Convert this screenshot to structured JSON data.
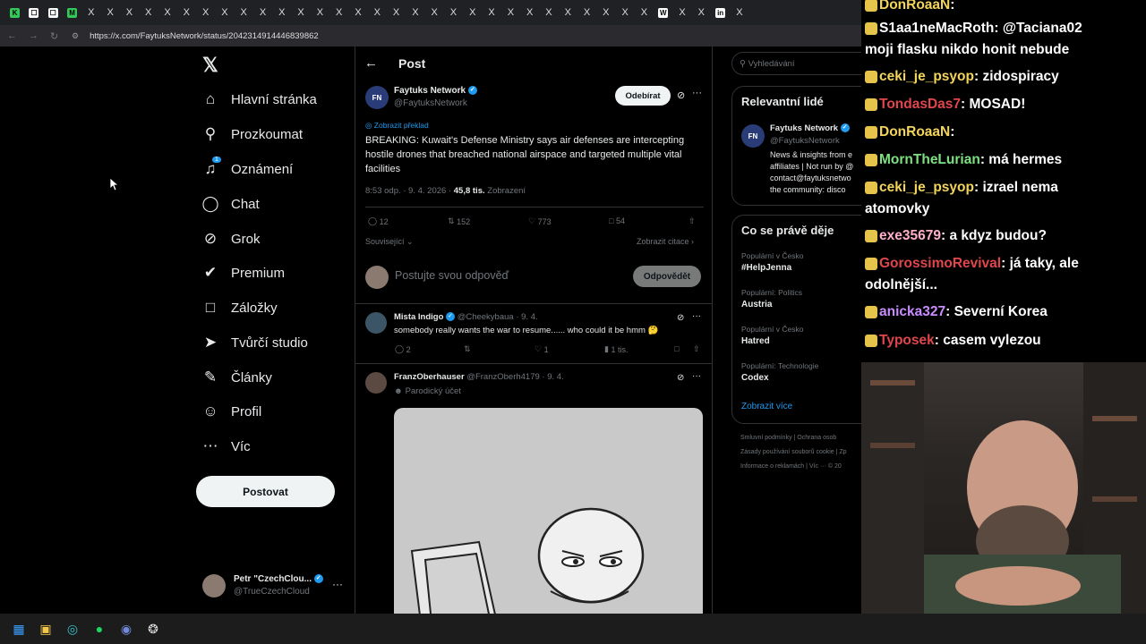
{
  "browser": {
    "url": "https://x.com/FaytuksNetwork/status/2042314914446839862",
    "tab_marks": [
      "K",
      "☐",
      "☐",
      "M",
      "X",
      "X",
      "X",
      "X",
      "X",
      "X",
      "X",
      "X",
      "X",
      "X",
      "X",
      "X",
      "X",
      "X",
      "X",
      "X",
      "X",
      "X",
      "X",
      "X",
      "X",
      "X",
      "X",
      "X",
      "X",
      "X",
      "X",
      "X",
      "X",
      "X",
      "W",
      "X",
      "X",
      "in",
      "X"
    ]
  },
  "nav": {
    "home": "Hlavní stránka",
    "explore": "Prozkoumat",
    "notifications": "Oznámení",
    "notif_count": "1",
    "chat": "Chat",
    "grok": "Grok",
    "premium": "Premium",
    "bookmarks": "Záložky",
    "creator_studio": "Tvůrčí studio",
    "articles": "Články",
    "profile": "Profil",
    "more": "Víc",
    "post_button": "Postovat",
    "account_name": "Petr \"CzechClou...",
    "account_handle": "@TrueCzechCloud"
  },
  "main": {
    "header_title": "Post",
    "post": {
      "author_name": "Faytuks Network",
      "author_handle": "@FaytuksNetwork",
      "follow_label": "Odebírat",
      "translate_label": "Zobrazit překlad",
      "text": "BREAKING: Kuwait's Defense Ministry says air defenses are intercepting hostile drones that breached national airspace and targeted multiple vital facilities",
      "time": "8:53 odp. · 9. 4. 2026 ·",
      "views_count": "45,8 tis.",
      "views_label": "Zobrazení",
      "replies": "12",
      "reposts": "152",
      "likes": "773",
      "bookmarks": "54",
      "related_label": "Související",
      "quotes_label": "Zobrazit citace"
    },
    "reply_box": {
      "placeholder": "Postujte svou odpověď",
      "button": "Odpovědět"
    },
    "replies": [
      {
        "name": "Mista Indigo",
        "handle": "@Cheekybaua",
        "date": "· 9. 4.",
        "text": "somebody really wants the war to resume...... who could it be hmm 🤔",
        "replies": "2",
        "likes": "1",
        "views": "1 tis."
      },
      {
        "name": "FranzOberhauser",
        "handle": "@FranzOberh4179",
        "date": "· 9. 4.",
        "subtitle": "Parodický účet"
      }
    ]
  },
  "sidebar": {
    "search_placeholder": "Vyhledávání",
    "relevant_title": "Relevantní lidé",
    "relevant_name": "Faytuks Network",
    "relevant_handle": "@FaytuksNetwork",
    "relevant_bio_1": "News & insights from e",
    "relevant_bio_2": "affiliates | Not run by @",
    "relevant_bio_3": "contact@faytuksnetwo",
    "relevant_bio_4": "the community: disco",
    "trends_title": "Co se právě děje",
    "trends": [
      {
        "context": "Populární v Česko",
        "name": "#HelpJenna"
      },
      {
        "context": "Populární: Politics",
        "name": "Austria"
      },
      {
        "context": "Populární v Česko",
        "name": "Hatred"
      },
      {
        "context": "Populární: Technologie",
        "name": "Codex"
      }
    ],
    "show_more": "Zobrazit více",
    "footer_1": "Smluvní podmínky  |  Ochrana osob",
    "footer_2": "Zásady používání souborů cookie  |  Zp",
    "footer_3": "Informace o reklamách  |  Víc ···  © 20"
  },
  "chat": [
    {
      "user": "DonRoaaN",
      "color": "#f3d55b",
      "msg": ""
    },
    {
      "user": "S1aa1neMacRoth",
      "color": "#ffffff",
      "msg": "@Taciana02"
    },
    {
      "user": "",
      "color": "#ffffff",
      "msg": "moji flasku nikdo honit nebude"
    },
    {
      "user": "ceki_je_psyop",
      "color": "#f3d55b",
      "msg": "zidospiracy"
    },
    {
      "user": "TondasDas7",
      "color": "#e0464c",
      "msg": "MOSAD!"
    },
    {
      "user": "DonRoaaN",
      "color": "#f3d55b",
      "msg": ""
    },
    {
      "user": "MornTheLurian",
      "color": "#7ee081",
      "msg": "má hermes"
    },
    {
      "user": "ceki_je_psyop",
      "color": "#f3d55b",
      "msg": "izrael nema"
    },
    {
      "user": "",
      "color": "#ffffff",
      "msg": "atomovky"
    },
    {
      "user": "exe35679",
      "color": "#ffb0c8",
      "msg": "a kdyz budou?"
    },
    {
      "user": "GorossimoRevival",
      "color": "#e0464c",
      "msg": "já taky, ale"
    },
    {
      "user": "",
      "color": "#ffffff",
      "msg": "odolnější..."
    },
    {
      "user": "anicka327",
      "color": "#c98cff",
      "msg": "Severní Korea"
    },
    {
      "user": "Typosek",
      "color": "#e0464c",
      "msg": "casem vylezou"
    }
  ]
}
